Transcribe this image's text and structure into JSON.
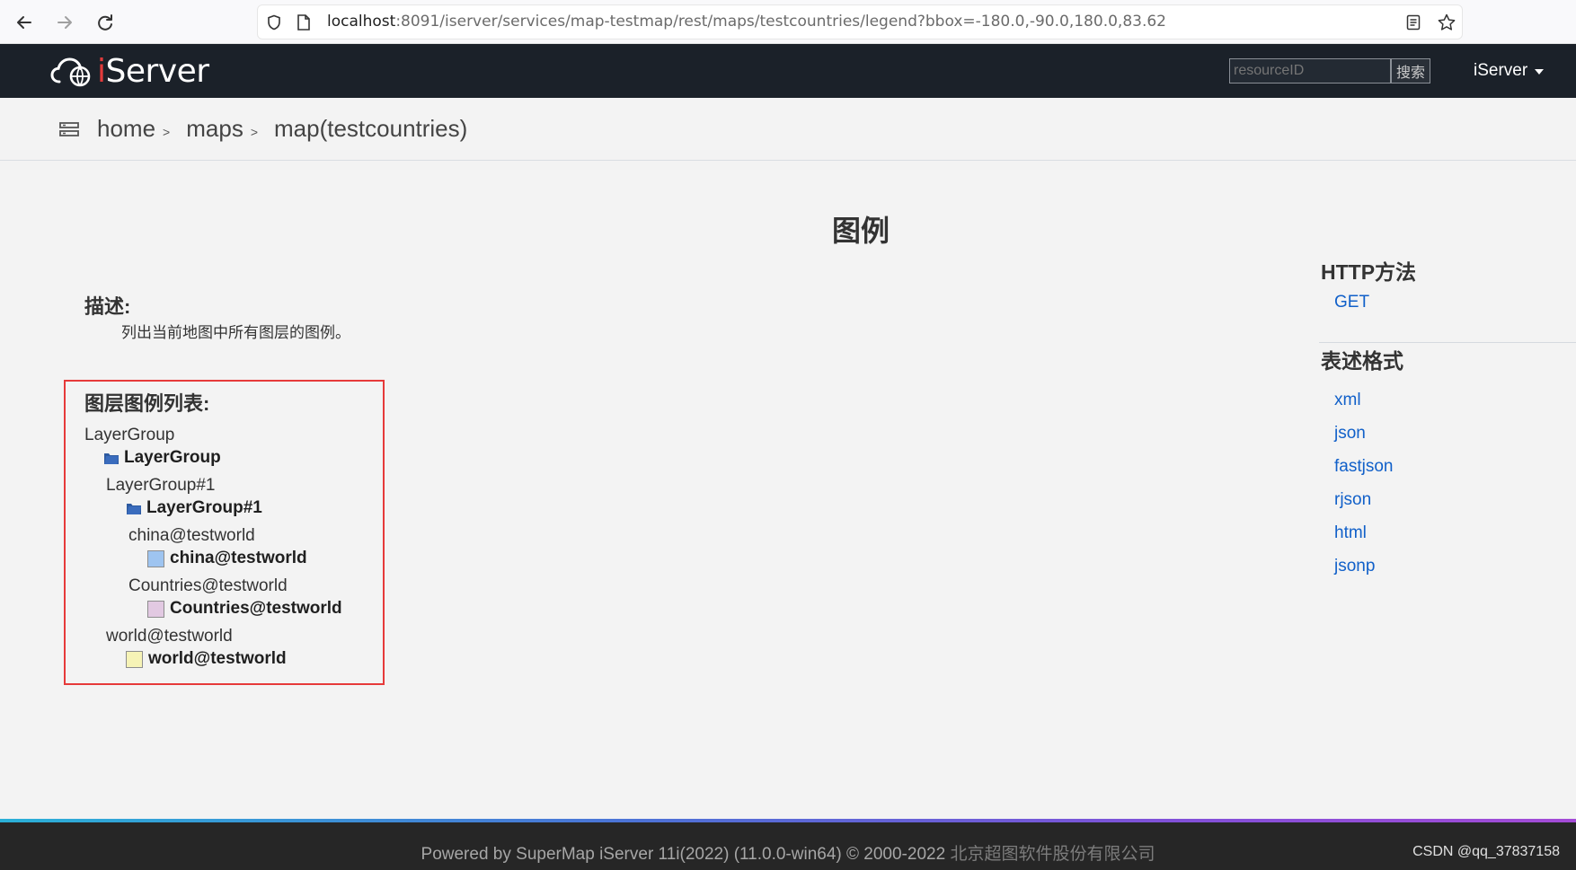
{
  "browser": {
    "url_host": "localhost",
    "url_rest": ":8091/iserver/services/map-testmap/rest/maps/testcountries/legend?bbox=-180.0,-90.0,180.0,83.62"
  },
  "header": {
    "logo_prefix": "i",
    "logo_suffix": "Server",
    "search_placeholder": "resourceID",
    "search_button": "搜索",
    "user_menu": "iServer"
  },
  "breadcrumb": {
    "items": [
      "home",
      "maps",
      "map(testcountries)"
    ],
    "separator": ">"
  },
  "main": {
    "title": "图例",
    "description_heading": "描述:",
    "description_text": "列出当前地图中所有图层的图例。",
    "legend_heading": "图层图例列表:",
    "legend_rows": [
      {
        "label": "LayerGroup",
        "bold": false
      },
      {
        "label": "LayerGroup",
        "bold": true,
        "icon": "folder-icon"
      },
      {
        "label": "LayerGroup#1",
        "bold": false
      },
      {
        "label": "LayerGroup#1",
        "bold": true,
        "icon": "folder-icon"
      },
      {
        "label": "china@testworld",
        "bold": false
      },
      {
        "label": "china@testworld",
        "bold": true,
        "swatch": "#9ec4f0"
      },
      {
        "label": "Countries@testworld",
        "bold": false
      },
      {
        "label": "Countries@testworld",
        "bold": true,
        "swatch": "#e2c9e2"
      },
      {
        "label": "world@testworld",
        "bold": false
      },
      {
        "label": "world@testworld",
        "bold": true,
        "swatch": "#f6f3b6"
      }
    ]
  },
  "side": {
    "http_heading": "HTTP方法",
    "http_methods": [
      "GET"
    ],
    "formats_heading": "表述格式",
    "formats": [
      "xml",
      "json",
      "fastjson",
      "rjson",
      "html",
      "jsonp"
    ]
  },
  "footer": {
    "text": "Powered by SuperMap iServer 11i(2022) (11.0.0-win64) © 2000-2022 ",
    "company": "北京超图软件股份有限公司",
    "watermark": "CSDN @qq_37837158"
  },
  "colors": {
    "accent_link": "#1160c9",
    "highlight_border": "#e63a3a",
    "header_bg": "#1b2129"
  }
}
